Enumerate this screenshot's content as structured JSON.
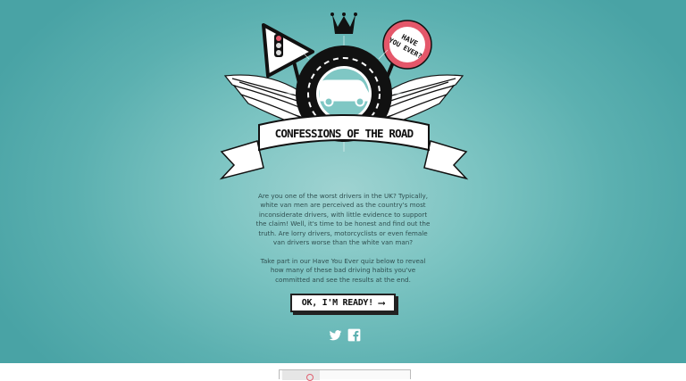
{
  "hero": {
    "badge_text": [
      "HAVE",
      "YOU EVER?"
    ],
    "banner_title": "CONFESSIONS OF THE ROAD",
    "intro_paragraph": "Are you one of the worst drivers in the UK? Typically, white van men are perceived as the country's most inconsiderate drivers, with little evidence to support the claim! Well, it's time to be honest and find out the truth. Are lorry drivers, motorcyclists or even female van drivers worse than the white van man?",
    "instructions_paragraph": "Take part in our Have You Ever quiz below to reveal how many of these bad driving habits you've committed and see the results at the end.",
    "cta_label": "OK, I'M READY!",
    "cta_icon": "arrow-right-icon"
  },
  "social": {
    "icons": [
      "twitter-icon",
      "facebook-icon"
    ]
  },
  "colors": {
    "background": "#5bb0b0",
    "badge_red": "#e4576a",
    "ink": "#111111"
  }
}
